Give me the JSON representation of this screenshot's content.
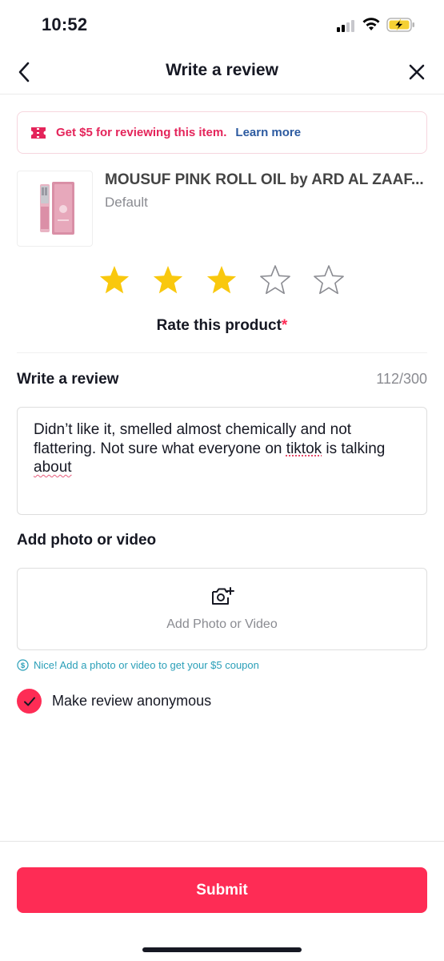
{
  "status_bar": {
    "time": "10:52",
    "icons": [
      "signal-icon",
      "wifi-icon",
      "battery-charging-icon"
    ]
  },
  "header": {
    "title": "Write a review",
    "back_icon": "chevron-left-icon",
    "close_icon": "close-icon"
  },
  "promo": {
    "icon": "coupon-ticket-icon",
    "text": "Get $5 for reviewing this item.",
    "link": "Learn more",
    "accent_color": "#e4245a",
    "link_color": "#2c5aa0"
  },
  "product": {
    "name": "MOUSUF PINK ROLL OIL by ARD AL ZAAF...",
    "variant": "Default"
  },
  "rating": {
    "value": 3,
    "max": 5,
    "label": "Rate this product",
    "required_mark": "*",
    "star_color": "#f9c80e"
  },
  "review": {
    "label": "Write a review",
    "counter": "112/300",
    "text_part1": "Didn’t like it, smelled almost chemically and not flattering. Not sure what everyone on ",
    "text_word_tiktok": "tiktok",
    "text_part2": " is talking ",
    "text_word_about": "about"
  },
  "media": {
    "label": "Add photo or video",
    "upload_label": "Add Photo or Video",
    "hint": "Nice! Add a photo or video to get your $5 coupon",
    "hint_color": "#2a9fb8"
  },
  "anonymous": {
    "label": "Make review anonymous",
    "checked": true
  },
  "submit": {
    "label": "Submit",
    "color": "#fe2c55"
  }
}
